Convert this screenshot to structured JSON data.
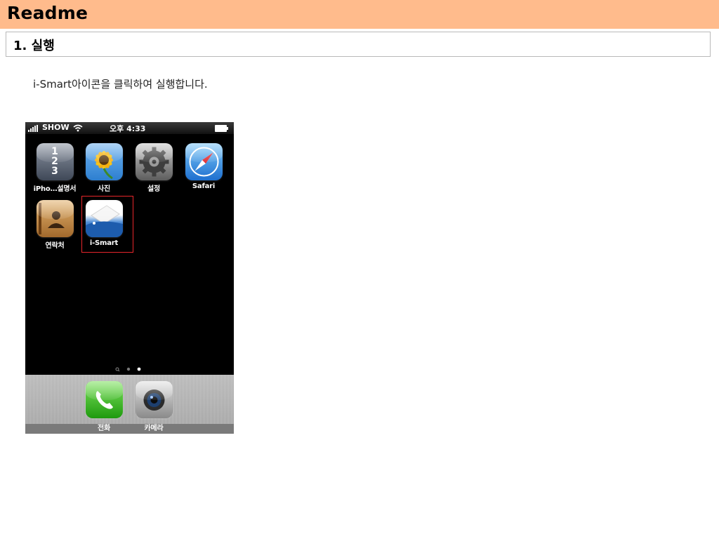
{
  "page": {
    "title": "Readme",
    "section": "1. 실행",
    "instruction": "i-Smart아이콘을 클릭하여 실행합니다."
  },
  "phone": {
    "status_bar": {
      "carrier": "SHOW",
      "time": "오후 4:33",
      "signal_icon": "signal-icon",
      "wifi_icon": "wifi-icon",
      "battery_icon": "battery-icon"
    },
    "apps": [
      {
        "label": "iPho…설명서",
        "icon": "guide-icon",
        "glyphs": [
          "1",
          "2",
          "3"
        ]
      },
      {
        "label": "사진",
        "icon": "sunflower-icon"
      },
      {
        "label": "설정",
        "icon": "gear-icon"
      },
      {
        "label": "Safari",
        "icon": "compass-icon"
      },
      {
        "label": "연락처",
        "icon": "contacts-icon"
      },
      {
        "label": "i-Smart",
        "icon": "i-smart-icon",
        "highlighted": true
      }
    ],
    "dock": [
      {
        "label": "전화",
        "icon": "phone-icon"
      },
      {
        "label": "카메라",
        "icon": "camera-icon"
      }
    ]
  },
  "colors": {
    "title_bar": "#ffbb8c",
    "highlight": "#e8262b"
  }
}
